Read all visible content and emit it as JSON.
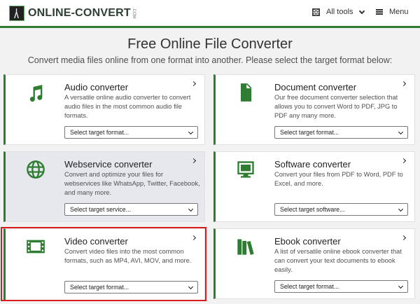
{
  "header": {
    "logo_text": "ONLINE-CONVERT",
    "logo_domain": ".COM",
    "all_tools": "All tools",
    "menu": "Menu"
  },
  "page": {
    "title": "Free Online File Converter",
    "subtitle": "Convert media files online from one format into another. Please select the target format below:"
  },
  "converters": [
    {
      "title": "Audio converter",
      "description": "A versatile online audio converter to convert audio files in the most common audio file formats.",
      "select": "Select target format...",
      "icon": "music-note-icon"
    },
    {
      "title": "Document converter",
      "description": "Our free document converter selection that allows you to convert Word to PDF, JPG to PDF any many more.",
      "select": "Select target format...",
      "icon": "document-icon"
    },
    {
      "title": "Webservice converter",
      "description": "Convert and optimize your files for webservices like WhatsApp, Twitter, Facebook, and many more.",
      "select": "Select target service...",
      "icon": "globe-icon"
    },
    {
      "title": "Software converter",
      "description": "Convert your files from PDF to Word, PDF to Excel, and more.",
      "select": "Select target software...",
      "icon": "monitor-icon"
    },
    {
      "title": "Video converter",
      "description": "Convert video files into the most common formats, such as MP4, AVI, MOV, and more.",
      "select": "Select target format...",
      "icon": "film-icon"
    },
    {
      "title": "Ebook converter",
      "description": "A list of versatile online ebook converter that can convert your text documents to ebook easily.",
      "select": "Select target format...",
      "icon": "books-icon"
    }
  ],
  "colors": {
    "accent": "#2e7d32",
    "highlight": "#d91c1c",
    "hover_card": "#e6e8ed"
  }
}
